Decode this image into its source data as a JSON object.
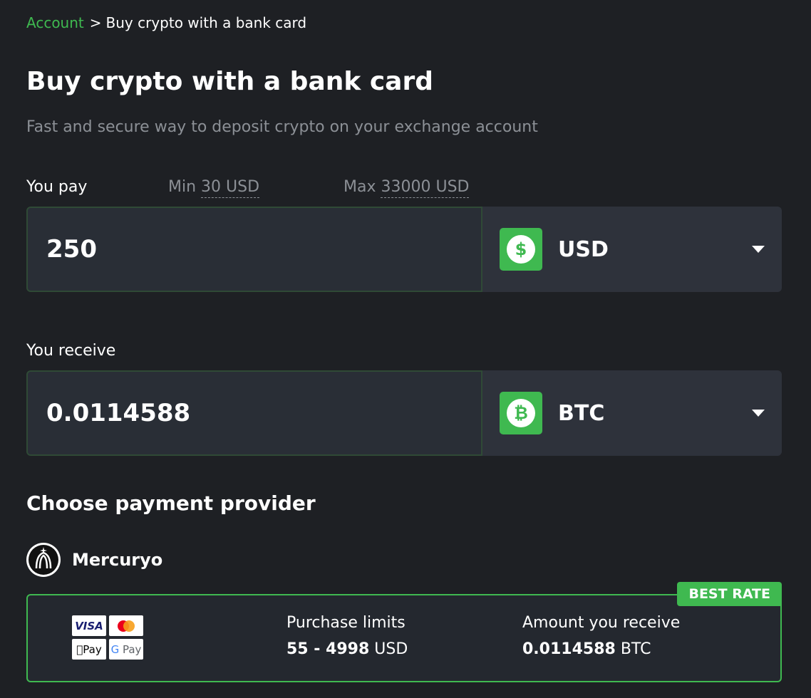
{
  "breadcrumb": {
    "root": "Account",
    "separator": ">",
    "current": "Buy crypto with a bank card"
  },
  "page": {
    "title": "Buy crypto with a bank card",
    "subtitle": "Fast and secure way to deposit crypto on your exchange account"
  },
  "pay": {
    "label": "You pay",
    "min_label": "Min",
    "min_value": "30 USD",
    "max_label": "Max",
    "max_value": "33000 USD",
    "amount": "250",
    "currency": "USD",
    "currency_icon": "dollar-icon"
  },
  "receive": {
    "label": "You receive",
    "amount": "0.0114588",
    "currency": "BTC",
    "currency_icon": "bitcoin-icon"
  },
  "providers": {
    "section_title": "Choose payment provider",
    "items": [
      {
        "name": "Mercuryo",
        "badge": "BEST RATE",
        "payment_methods": [
          "VISA",
          "Mastercard",
          "Apple Pay",
          "Google Pay"
        ],
        "limits_label": "Purchase limits",
        "limits_value": "55 - 4998",
        "limits_currency": "USD",
        "amount_label": "Amount you receive",
        "amount_value": "0.0114588",
        "amount_currency": "BTC"
      }
    ]
  },
  "colors": {
    "accent": "#3fb950",
    "background": "#1e2024",
    "field": "#292e36",
    "muted": "#8c9096"
  }
}
